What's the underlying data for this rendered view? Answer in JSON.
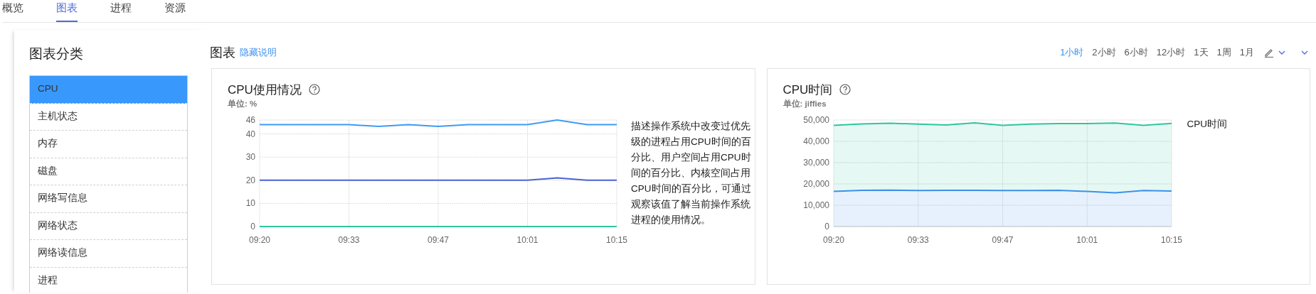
{
  "tabs": [
    {
      "label": "概览",
      "selected": false
    },
    {
      "label": "图表",
      "selected": true
    },
    {
      "label": "进程",
      "selected": false
    },
    {
      "label": "资源",
      "selected": false
    }
  ],
  "sidebar": {
    "title": "图表分类",
    "items": [
      {
        "label": "CPU",
        "selected": true
      },
      {
        "label": "主机状态",
        "selected": false
      },
      {
        "label": "内存",
        "selected": false
      },
      {
        "label": "磁盘",
        "selected": false
      },
      {
        "label": "网络写信息",
        "selected": false
      },
      {
        "label": "网络状态",
        "selected": false
      },
      {
        "label": "网络读信息",
        "selected": false
      },
      {
        "label": "进程",
        "selected": false
      }
    ]
  },
  "header": {
    "title": "图表",
    "toggle_link": "隐藏说明"
  },
  "time_ranges": [
    {
      "label": "1小时",
      "selected": true
    },
    {
      "label": "2小时",
      "selected": false
    },
    {
      "label": "6小时",
      "selected": false
    },
    {
      "label": "12小时",
      "selected": false
    },
    {
      "label": "1天",
      "selected": false
    },
    {
      "label": "1周",
      "selected": false
    },
    {
      "label": "1月",
      "selected": false
    }
  ],
  "charts": [
    {
      "title": "CPU使用情况",
      "unit": "单位: %",
      "description": "描述操作系统中改变过优先级的进程占用CPU时间的百分比、用户空间占用CPU时间的百分比、内核空间占用CPU时间的百分比，可通过观察该值了解当前操作系统进程的使用情况。",
      "chart_data": {
        "type": "line",
        "grid": true,
        "categories": [
          "09:20",
          null,
          null,
          "09:33",
          null,
          null,
          "09:47",
          null,
          null,
          "10:01",
          null,
          null,
          "10:15"
        ],
        "ylim": [
          0,
          46
        ],
        "yticks": [
          0,
          10,
          20,
          30,
          40,
          46
        ],
        "series": [
          {
            "color": "#3d9bf5",
            "values": [
              44,
              44,
              44,
              44,
              43.2,
              44,
              43.2,
              44,
              44,
              44,
              46,
              44,
              44
            ]
          },
          {
            "color": "#4a63d0",
            "values": [
              20,
              20,
              20,
              20,
              20,
              20,
              20,
              20,
              20,
              20,
              21,
              20,
              20
            ]
          },
          {
            "color": "#2ec7a0",
            "values": [
              0,
              0,
              0,
              0,
              0,
              0,
              0,
              0,
              0,
              0,
              0,
              0,
              0
            ]
          }
        ]
      }
    },
    {
      "title": "CPU时间",
      "unit": "单位: jiffies",
      "description": "CPU时间",
      "chart_data": {
        "type": "area",
        "stacked": true,
        "grid": true,
        "categories": [
          "09:20",
          null,
          null,
          "09:33",
          null,
          null,
          "09:47",
          null,
          null,
          "10:01",
          null,
          null,
          "10:15"
        ],
        "ylim": [
          0,
          50000
        ],
        "yticks": [
          {
            "value": 0,
            "label": "0"
          },
          {
            "value": 10000,
            "label": "10,000"
          },
          {
            "value": 20000,
            "label": "20,000"
          },
          {
            "value": 30000,
            "label": "30,000"
          },
          {
            "value": 40000,
            "label": "40,000"
          },
          {
            "value": 50000,
            "label": "50,000"
          }
        ],
        "series": [
          {
            "color": "#3d8ef0",
            "values": [
              16500,
              17000,
              17100,
              16900,
              17000,
              17000,
              16900,
              16900,
              17000,
              16500,
              15800,
              16900,
              16700
            ]
          },
          {
            "color": "#2ec79a",
            "values": [
              31000,
              31200,
              31400,
              31200,
              30700,
              31700,
              30600,
              31200,
              31300,
              31800,
              32800,
              30600,
              31700
            ]
          }
        ]
      }
    }
  ]
}
